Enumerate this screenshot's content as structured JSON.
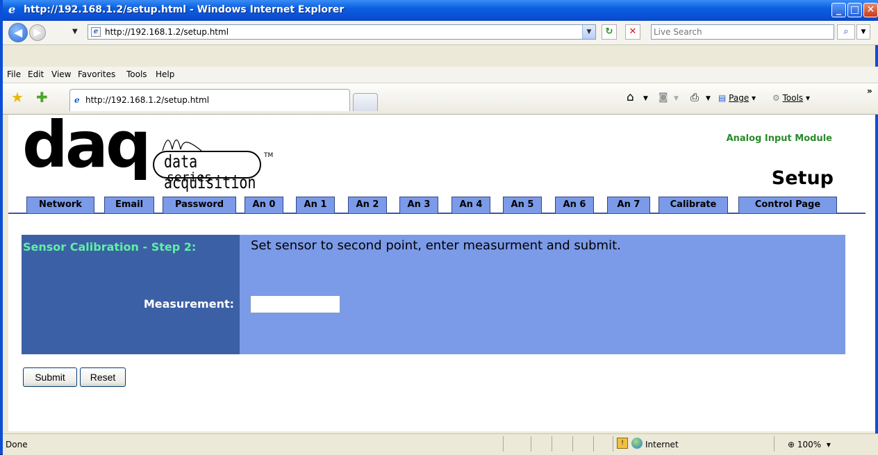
{
  "window": {
    "title": "http://192.168.1.2/setup.html - Windows Internet Explorer",
    "minimize": "_",
    "maximize": "□",
    "close": "✕"
  },
  "address_bar": {
    "url": "http://192.168.1.2/setup.html",
    "search_placeholder": "Live Search"
  },
  "menu": {
    "items": [
      "File",
      "Edit",
      "View",
      "Favorites",
      "Tools",
      "Help"
    ]
  },
  "tabs": {
    "active_label": "http://192.168.1.2/setup.html"
  },
  "toolbar": {
    "page_label": "Page",
    "tools_label": "Tools",
    "more": "»"
  },
  "page": {
    "logo": {
      "brand": "daq",
      "tagline_top": "data acquisition",
      "tagline_bottom": "series",
      "tm": "TM"
    },
    "module_title": "Analog Input Module",
    "page_title": "Setup",
    "nav": [
      "Network",
      "Email",
      "Password",
      "An 0",
      "An 1",
      "An 2",
      "An 3",
      "An 4",
      "An 5",
      "An 6",
      "An 7",
      "Calibrate",
      "Control Page"
    ],
    "calibration": {
      "step_label": "Sensor Calibration - Step 2:",
      "instruction": "Set sensor to second point, enter measurment and submit.",
      "measurement_label": "Measurement:",
      "measurement_value": ""
    },
    "buttons": {
      "submit": "Submit",
      "reset": "Reset"
    }
  },
  "status": {
    "text": "Done",
    "zone": "Internet",
    "zoom": "100%"
  },
  "colors": {
    "nav_tab_bg": "#7b9ae8",
    "calib_left_bg": "#3c60a6",
    "step_label": "#5df2a0",
    "module_title": "#2b8a2b"
  }
}
